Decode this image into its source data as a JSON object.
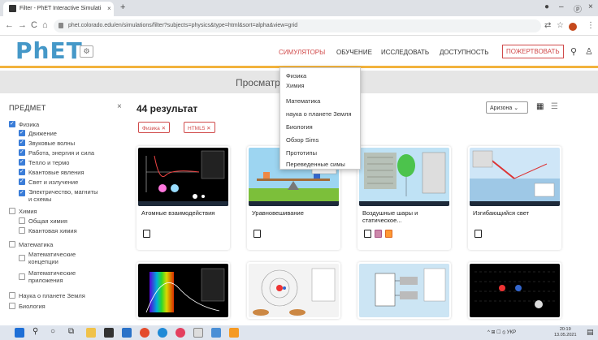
{
  "browser": {
    "tab_title": "Filter - PhET Interactive Simulati",
    "tab_close": "×",
    "new_tab": "+",
    "url": "phet.colorado.edu/en/simulations/filter?subjects=physics&type=html&sort=alpha&view=grid",
    "window_controls": [
      "●",
      "–",
      "ⓟ",
      "×"
    ]
  },
  "site": {
    "logo_text": "PhET",
    "nav": {
      "simulations": "СИМУЛЯТОРЫ",
      "teaching": "ОБУЧЕНИЕ",
      "research": "ИССЛЕДОВАТЬ",
      "accessibility": "ДОСТУПНОСТЬ",
      "donate": "ПОЖЕРТВОВАТЬ"
    },
    "page_title": "Просматривать  Фильтр"
  },
  "sim_menu": {
    "items": [
      "Физика",
      "Химия",
      "Математика",
      "наука о планете Земля",
      "Биология",
      "Обзор Sims",
      "Прототипы",
      "Переведенные симы"
    ]
  },
  "sidebar": {
    "header": "ПРЕДМЕТ",
    "close": "×",
    "items": [
      {
        "label": "Физика",
        "checked": true
      },
      {
        "label": "Движение",
        "checked": true
      },
      {
        "label": "Звуковые волны",
        "checked": true
      },
      {
        "label": "Работа, энергия и сила",
        "checked": true
      },
      {
        "label": "Тепло и термо",
        "checked": true
      },
      {
        "label": "Квантовые явления",
        "checked": true
      },
      {
        "label": "Свет и излучение",
        "checked": true
      },
      {
        "label": "Электричество, магниты",
        "label2": "и схемы",
        "checked": true
      },
      {
        "label": "Химия",
        "checked": false
      },
      {
        "label": "Общая химия",
        "checked": false
      },
      {
        "label": "Квантовая химия",
        "checked": false
      },
      {
        "label": "Математика",
        "checked": false
      },
      {
        "label": "Математические",
        "label2": "концепции",
        "checked": false
      },
      {
        "label": "Математические",
        "label2": "приложения",
        "checked": false
      },
      {
        "label": "Наука о планете Земля",
        "checked": false
      },
      {
        "label": "Биология",
        "checked": false
      }
    ]
  },
  "results": {
    "title": "44 результат",
    "chips": [
      "Физика ✕",
      "HTML5 ✕"
    ],
    "sort_value": "Аризона  ⌄",
    "grid_icon": "▦",
    "list_icon": "☰"
  },
  "cards": [
    {
      "title": "Атомные взаимодействия"
    },
    {
      "title": "Уравновешивание"
    },
    {
      "title": "Воздушные шары и статическое..."
    },
    {
      "title": "Изгибающийся свет"
    }
  ],
  "taskbar": {
    "tray": "^  ⊞  ☐  ⦸  УКР",
    "time": "20:19",
    "date": "13.05.2021"
  },
  "colors": {
    "accent_red": "#d04a4a",
    "phet_blue": "#4598c8",
    "header_stripe": "#f2b33d",
    "checkbox_blue": "#3b7dd8"
  }
}
